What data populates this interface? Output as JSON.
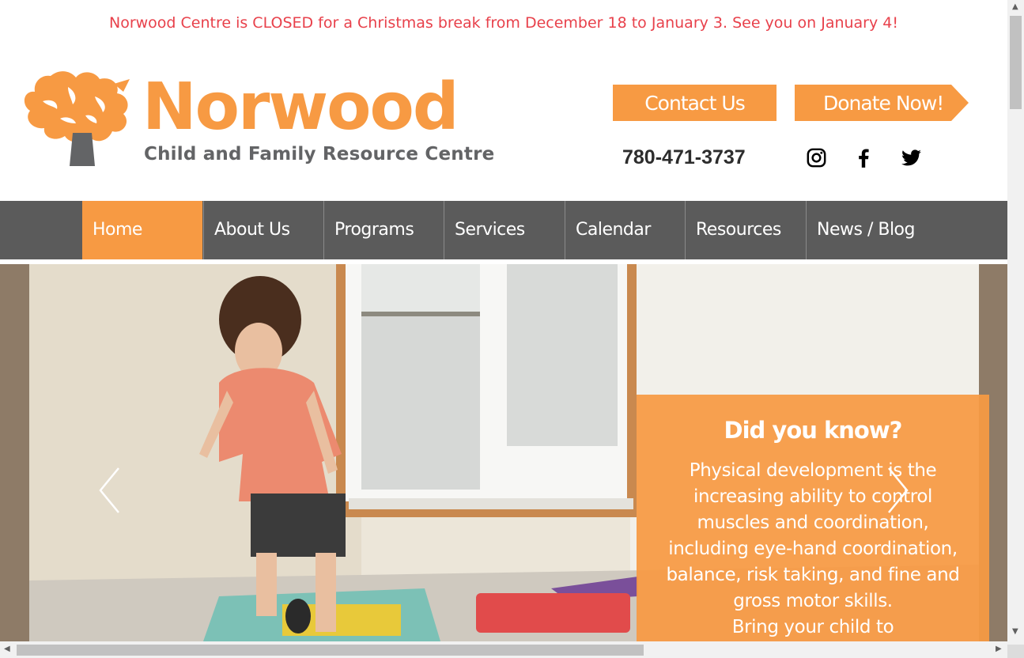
{
  "announcement": "Norwood Centre is CLOSED for a Christmas break from December 18 to January 3. See you on January 4!",
  "logo": {
    "name": "Norwood",
    "subtitle": "Child and Family Resource Centre"
  },
  "header": {
    "contact_label": "Contact Us",
    "donate_label": "Donate Now!",
    "phone": "780-471-3737",
    "social": [
      "instagram-icon",
      "facebook-icon",
      "twitter-icon"
    ]
  },
  "nav": {
    "items": [
      {
        "label": "Home",
        "active": true
      },
      {
        "label": "About Us",
        "active": false
      },
      {
        "label": "Programs",
        "active": false
      },
      {
        "label": "Services",
        "active": false
      },
      {
        "label": "Calendar",
        "active": false
      },
      {
        "label": "Resources",
        "active": false
      },
      {
        "label": "News / Blog",
        "active": false
      }
    ]
  },
  "hero": {
    "title": "Did you know?",
    "lines": [
      "Physical development is the",
      "increasing ability to control",
      "muscles and coordination,",
      "including eye-hand coordination,",
      "balance, risk taking, and fine and",
      "gross motor skills.",
      "Bring your child to"
    ]
  },
  "colors": {
    "brand_orange": "#f79a43",
    "brand_gray": "#636466",
    "nav_bg": "#5b5b5b",
    "announcement": "#e8414b"
  }
}
